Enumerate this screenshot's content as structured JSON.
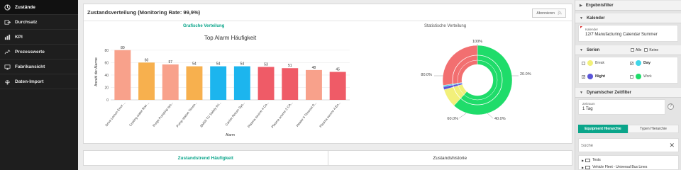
{
  "nav": [
    {
      "label": "Zustände",
      "icon": "states-icon",
      "active": true
    },
    {
      "label": "Durchsatz",
      "icon": "throughput-icon"
    },
    {
      "label": "KPI",
      "icon": "kpi-icon"
    },
    {
      "label": "Prozesswerte",
      "icon": "process-icon"
    },
    {
      "label": "Fabrikansicht",
      "icon": "factory-icon"
    },
    {
      "label": "Daten-Import",
      "icon": "import-icon"
    }
  ],
  "panel": {
    "title": "Zustandsverteilung (Monitoring Rate: 99,9%)",
    "subscribe": "Abonnieren",
    "tab_graphic": "Grafische Verteilung",
    "tab_statistic": "Statistische Verteilung"
  },
  "bottom_tabs": {
    "active": "Zustandstrend Häufigkeit",
    "other": "Zustandshistorie"
  },
  "right": {
    "results_filter": "Ergebnisfilter",
    "calendar": "Kalender",
    "calendar_label": "Kalender",
    "calendar_value": "12/7 Manufacturing Calendar Summer",
    "series": "Serien",
    "all": "Alle",
    "none": "Keine",
    "series_items": [
      {
        "label": "Break",
        "color": "#f2f07a",
        "checked": false,
        "bold": false
      },
      {
        "label": "Day",
        "color": "#3fd6e8",
        "checked": true,
        "bold": true
      },
      {
        "label": "Night",
        "color": "#5a55d8",
        "checked": true,
        "bold": true
      },
      {
        "label": "Work",
        "color": "#1fdc6a",
        "checked": false,
        "bold": false
      }
    ],
    "dyn_filter": "Dynamischer Zeitfilter",
    "period_label": "Zeitraum",
    "period_value": "1 Tag",
    "hier_tab_active": "Equipment Hierarchie",
    "hier_tab_other": "Typen Hierarchie",
    "search_placeholder": "Suche",
    "tree": [
      "Tests",
      "Vehicle Fleet - Universal Bus Lines"
    ]
  },
  "chart_data": [
    {
      "type": "bar",
      "title": "Top Alarm Häufigkeit",
      "xlabel": "Alarm",
      "ylabel": "Anzahl der Alarme",
      "ylim": [
        0,
        90
      ],
      "yticks": [
        0,
        20,
        40,
        60,
        80
      ],
      "categories": [
        "Drive Lemon Error ...",
        "Cooling water flow ...",
        "Purge Pumping sys...",
        "Pump station Timeo...",
        "BMS5 TC Safety Int...",
        "Carrier Return Sys...",
        "Plasma source 4 Co...",
        "Plasma source 2 CA...",
        "Heater 5 Timeout D...",
        "Plasma source 4 En..."
      ],
      "values": [
        80,
        60,
        57,
        54,
        54,
        54,
        53,
        51,
        48,
        45
      ],
      "colors": [
        "#f8a18b",
        "#f7b04e",
        "#f8a18b",
        "#f7b04e",
        "#1cb5ee",
        "#1cb5ee",
        "#ef5b67",
        "#ef5b67",
        "#f8a18b",
        "#ef5b67"
      ]
    },
    {
      "type": "pie",
      "labels": [
        "100%",
        "20.0%",
        "40.0%",
        "60.0%",
        "80.0%"
      ],
      "series": [
        {
          "name": "Work",
          "value": 61.8,
          "color": "#1fdc6a"
        },
        {
          "name": "Break",
          "value": 8.7,
          "color": "#f2f07a"
        },
        {
          "name": "Night",
          "value": 1.4,
          "color": "#5a55d8"
        },
        {
          "name": "Day",
          "value": 0.6,
          "color": "#3fd6e8"
        },
        {
          "name": "",
          "value": 27.5,
          "color": "#f26f70"
        }
      ]
    }
  ]
}
